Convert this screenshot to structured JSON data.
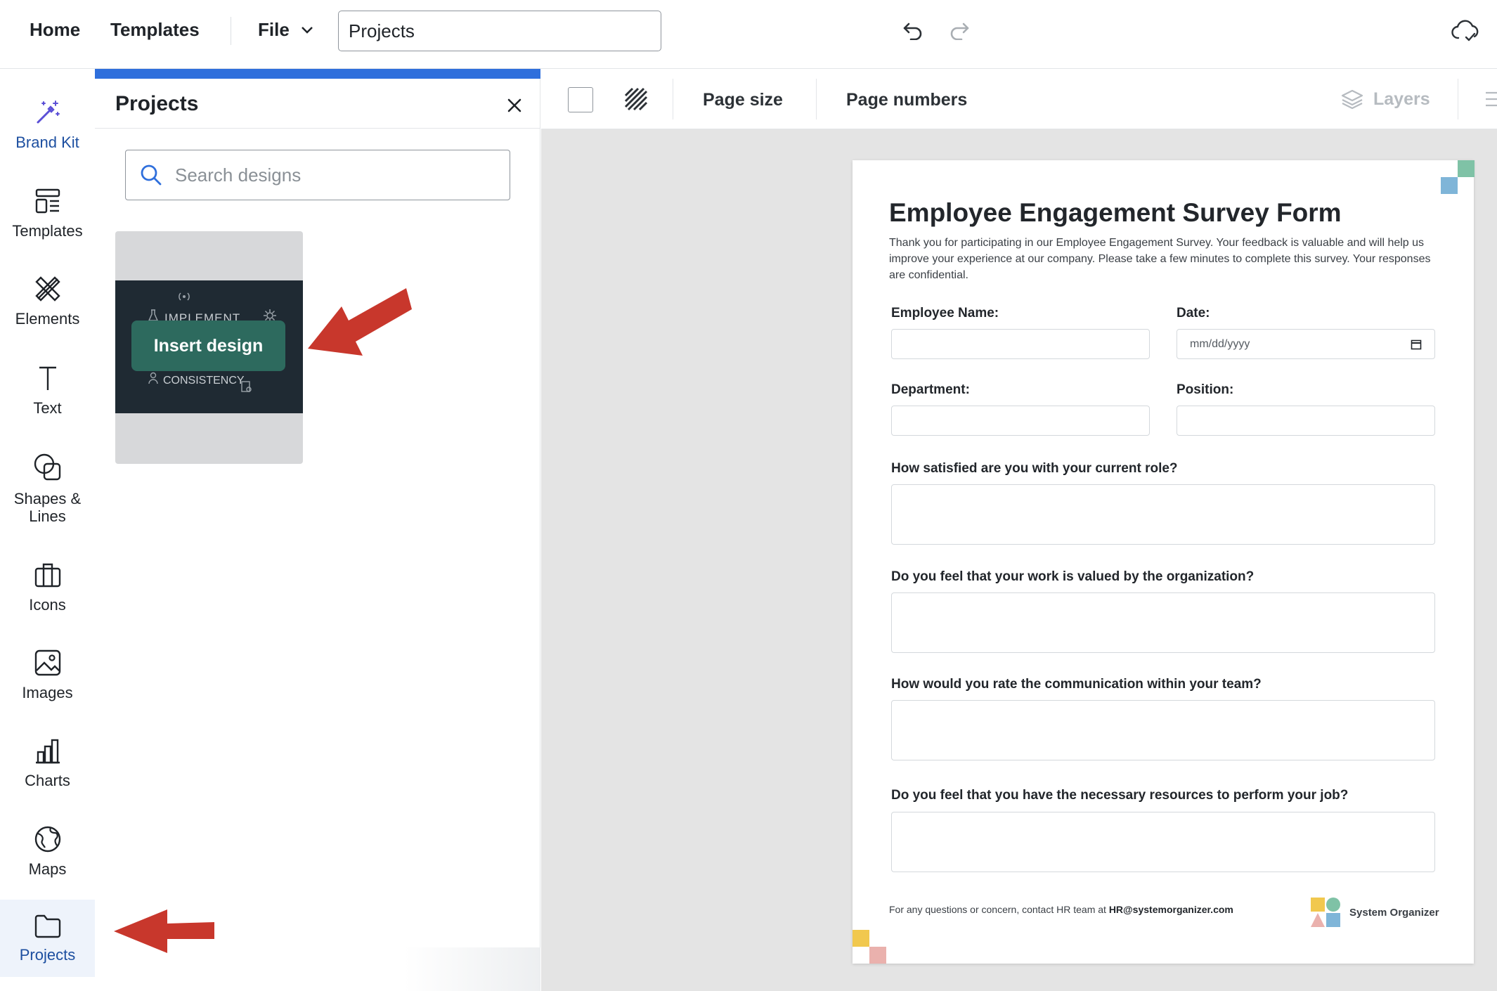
{
  "topbar": {
    "home": "Home",
    "templates": "Templates",
    "file": "File",
    "project_name": "Projects"
  },
  "rail": {
    "items": [
      {
        "label": "Brand Kit"
      },
      {
        "label": "Templates"
      },
      {
        "label": "Elements"
      },
      {
        "label": "Text"
      },
      {
        "label": "Shapes & Lines"
      },
      {
        "label": "Icons"
      },
      {
        "label": "Images"
      },
      {
        "label": "Charts"
      },
      {
        "label": "Maps"
      },
      {
        "label": "Projects"
      }
    ]
  },
  "panel": {
    "title": "Projects",
    "search_placeholder": "Search designs",
    "card": {
      "word_top": "IMPLEMENT",
      "word_bottom": "CONSISTENCY",
      "insert_label": "Insert design"
    }
  },
  "toolbar2": {
    "page_size": "Page size",
    "page_numbers": "Page numbers",
    "layers": "Layers"
  },
  "doc": {
    "title": "Employee Engagement Survey Form",
    "intro": "Thank you for participating in our Employee Engagement Survey. Your feedback is valuable and will help us improve your experience at our company. Please take a few minutes to complete this survey. Your responses are confidential.",
    "employee_name": "Employee Name:",
    "date": "Date:",
    "date_placeholder": "mm/dd/yyyy",
    "department": "Department:",
    "position": "Position:",
    "q1": "How satisfied are you with your current role?",
    "q2": "Do you feel that your work is valued by the organization?",
    "q3": "How would you rate the communication within your team?",
    "q4": "Do you feel that you have the necessary resources to perform your job?",
    "footer_prefix": "For any questions or concern, contact HR team at ",
    "footer_email": "HR@systemorganizer.com",
    "logo_text": "System Organizer"
  },
  "colors": {
    "accent_blue": "#2f6fdc",
    "insert_button": "#2d6a5e",
    "arrow_red": "#c8372c"
  }
}
